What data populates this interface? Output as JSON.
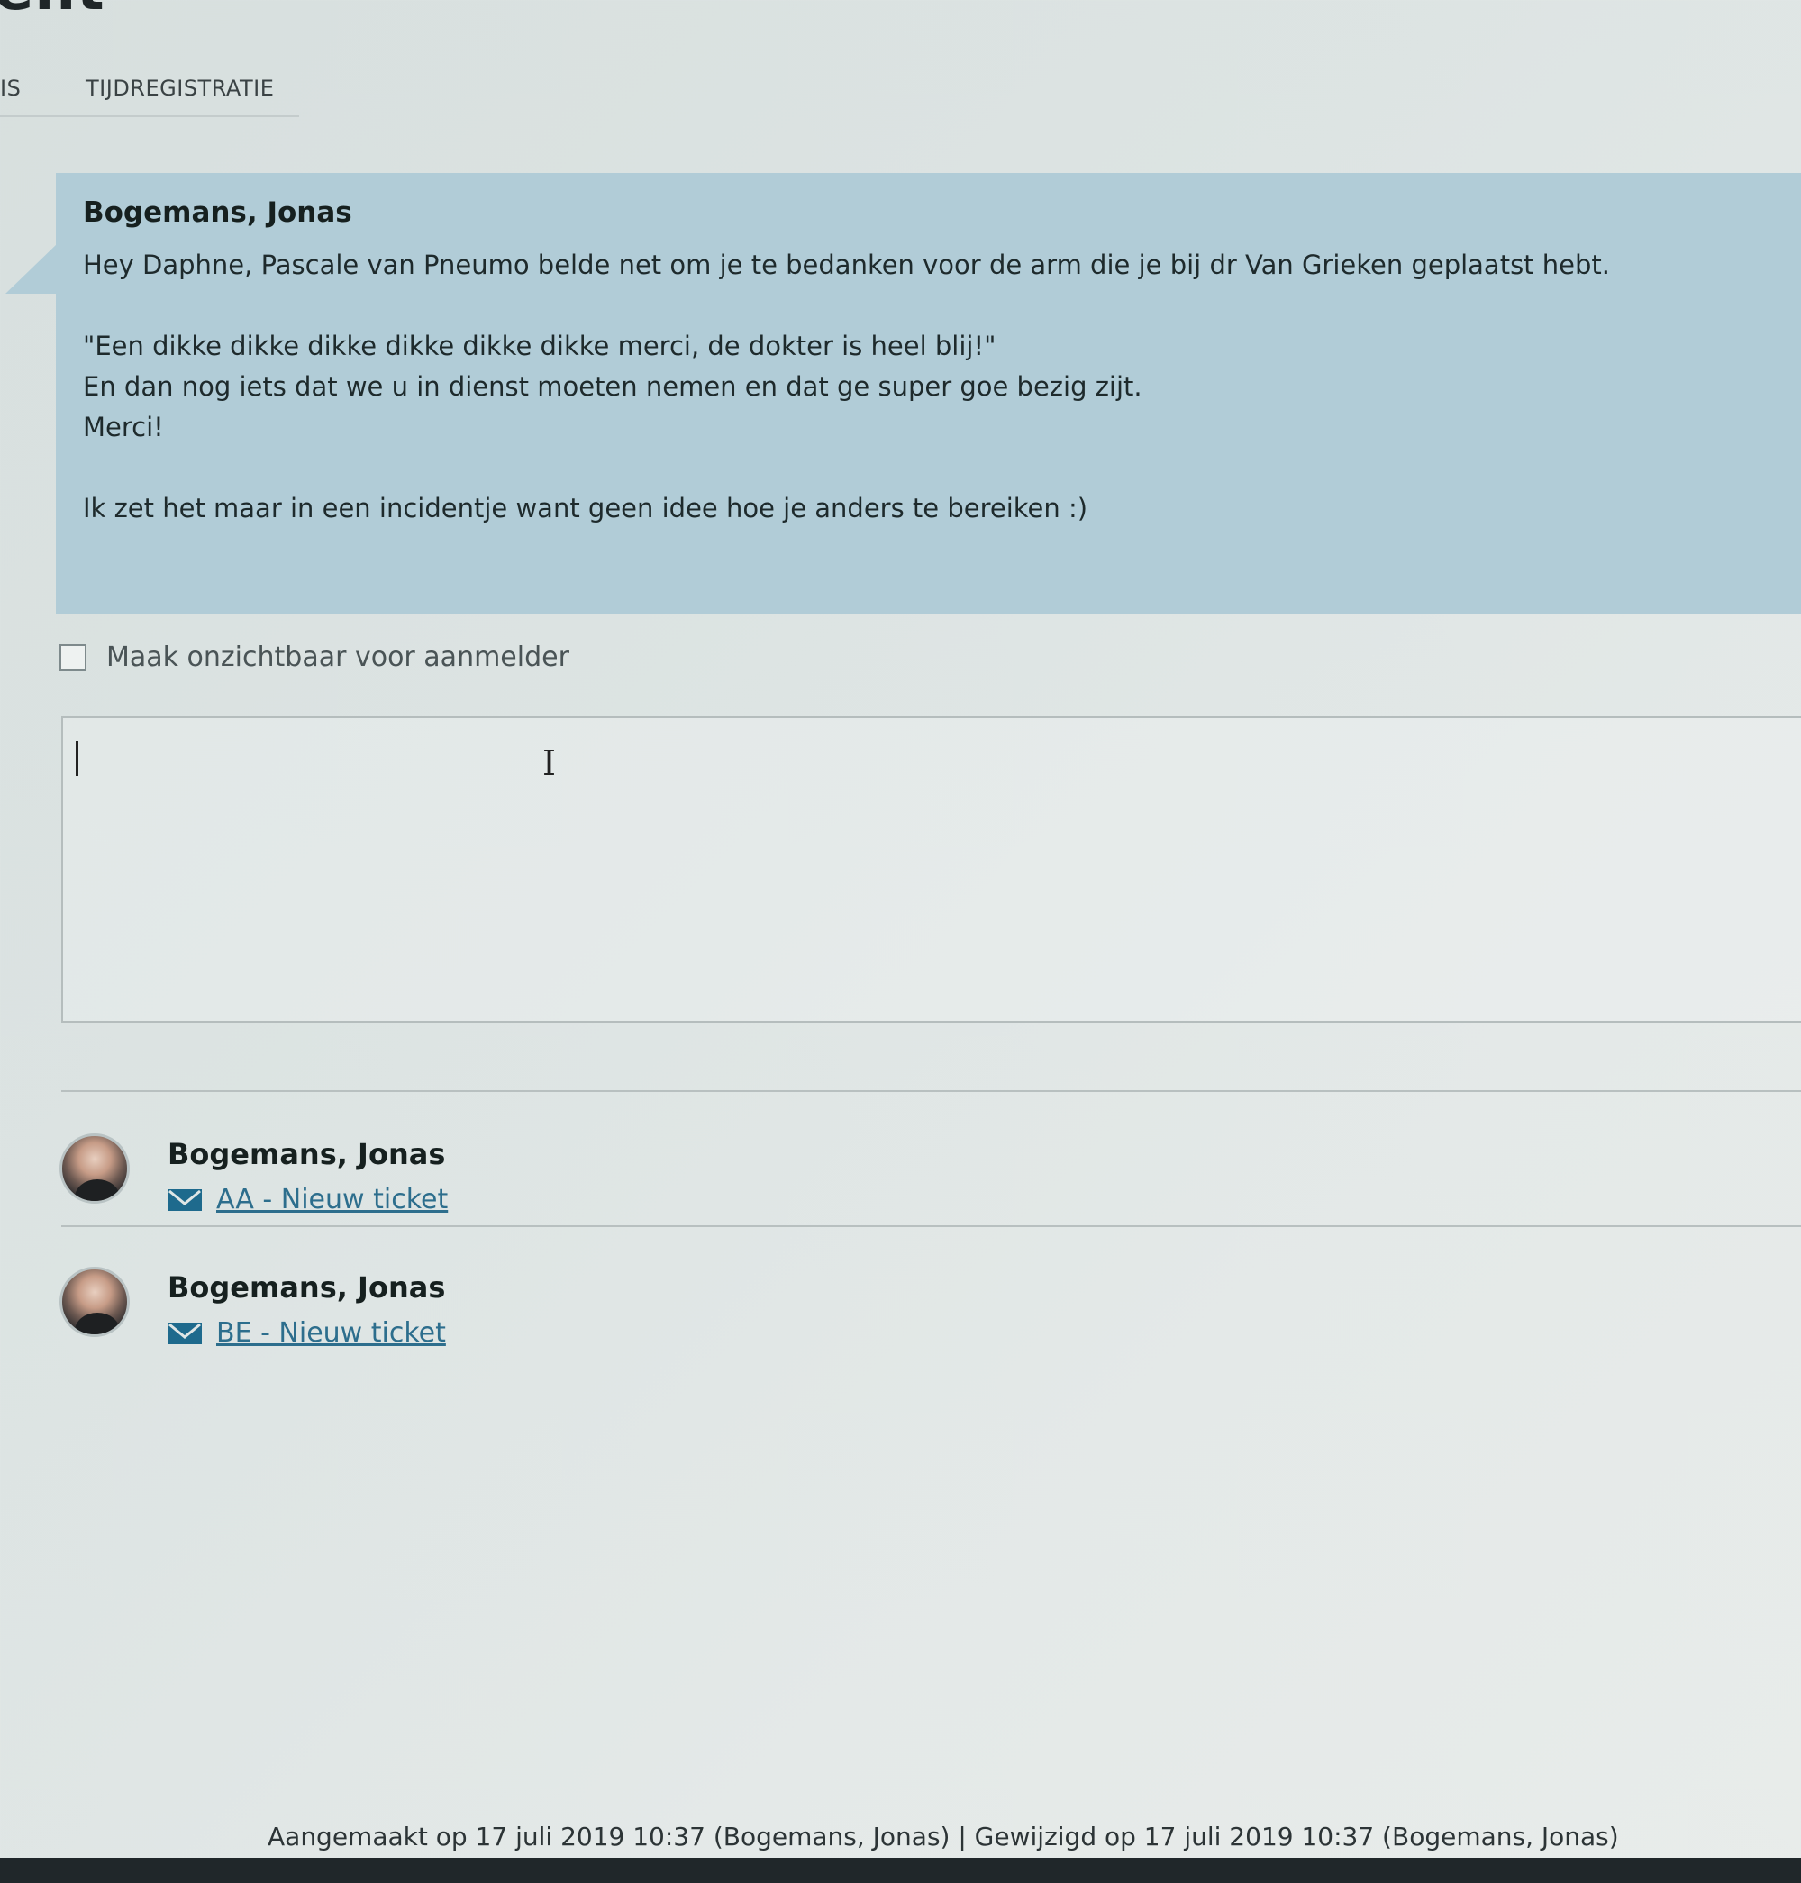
{
  "header": {
    "title_fragment": "ent",
    "tabs": [
      {
        "label": "IS"
      },
      {
        "label": "TIJDREGISTRATIE"
      }
    ]
  },
  "message": {
    "author": "Bogemans, Jonas",
    "lines": [
      "Hey Daphne, Pascale van Pneumo belde net om je te bedanken voor de arm die je bij dr Van Grieken geplaatst hebt.",
      "",
      "\"Een dikke dikke dikke dikke dikke dikke merci, de dokter is heel blij!\"",
      "En dan nog iets dat we u in dienst moeten nemen en dat ge super goe bezig zijt.",
      "Merci!",
      "",
      "Ik zet het maar in een incidentje want geen idee hoe je anders te bereiken :)"
    ]
  },
  "private_option": {
    "label": "Maak onzichtbaar voor aanmelder",
    "checked": false
  },
  "editor": {
    "value": ""
  },
  "activities": [
    {
      "author": "Bogemans, Jonas",
      "link": "AA - Nieuw ticket",
      "icon": "mail-icon"
    },
    {
      "author": "Bogemans, Jonas",
      "link": "BE - Nieuw ticket",
      "icon": "mail-icon"
    }
  ],
  "footer": {
    "text": "Aangemaakt op 17 juli 2019 10:37 (Bogemans, Jonas) | Gewijzigd op 17 juli 2019 10:37 (Bogemans, Jonas)"
  },
  "colors": {
    "message_bg": "#b1ccd7",
    "link": "#2d6e8d",
    "mail_icon": "#1e6a8d"
  }
}
